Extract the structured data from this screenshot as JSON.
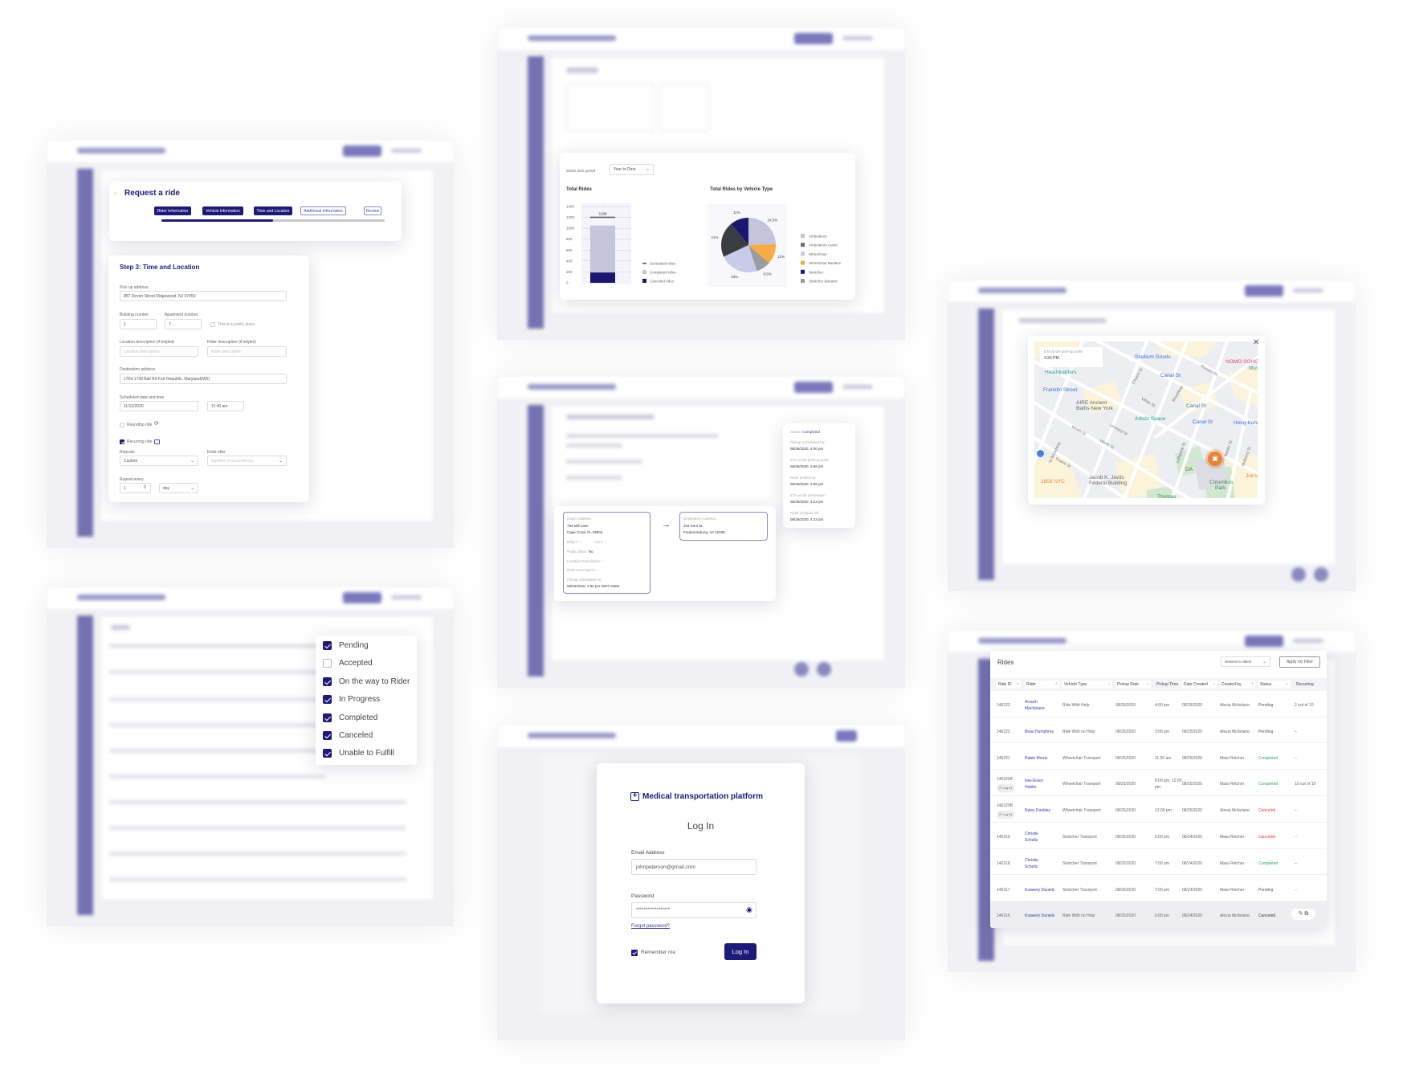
{
  "request_ride": {
    "title": "Request a ride",
    "steps": [
      {
        "label": "Rider Information",
        "done": true
      },
      {
        "label": "Vehicle Information",
        "done": true
      },
      {
        "label": "Time and Location",
        "done": true
      },
      {
        "label": "Additional Information",
        "done": false
      },
      {
        "label": "Review",
        "done": false
      }
    ],
    "progress_percent": 50,
    "form": {
      "title": "Step 3: Time and Location",
      "pickup_label": "Pick up address",
      "pickup_value": "857 Devon Street Ridgewood, NJ 07450",
      "building_label": "Building number",
      "building_value": "1",
      "apartment_label": "Apartment number",
      "apartment_value": "7",
      "public_place_label": "This is a public place",
      "location_desc_label": "Location description (if helpful)",
      "location_desc_placeholder": "Location description",
      "rider_desc_label": "Rider description (if helpful)",
      "rider_desc_placeholder": "Rider description",
      "destination_label": "Destination address",
      "destination_value": "1769-1799 Ball Rd Fort Republic, Maryland(MD)",
      "scheduled_label": "Scheduled date and time",
      "date_value": "11/12/2020",
      "time_value": "11:40 am",
      "roundtrip_label": "Roundtrip ride",
      "recurring_label": "Recurring ride",
      "repeats_label": "Repeats",
      "repeats_value": "Custom",
      "ends_after_label": "Ends after",
      "ends_after_placeholder": "Number of occurrences",
      "repeat_every_label": "Repeat every",
      "repeat_every_value": "1",
      "repeat_unit_value": "day"
    }
  },
  "dashboard": {
    "time_period_label": "Select time period",
    "time_period_value": "Year to Date"
  },
  "chart_data": [
    {
      "type": "bar",
      "title": "Total Rides",
      "ylim": [
        0,
        1400
      ],
      "yticks": [
        0,
        200,
        400,
        600,
        800,
        1000,
        1200,
        1400
      ],
      "grid": true,
      "legend": "right",
      "series": [
        {
          "name": "Scheduled rides",
          "value": 1198,
          "color": "#555555"
        },
        {
          "name": "Completed rides",
          "value": 860,
          "color": "#c5c5db"
        },
        {
          "name": "Canceled rides",
          "value": 190,
          "color": "#1b1670"
        }
      ],
      "data_label": "1198"
    },
    {
      "type": "pie",
      "title": "Total Rides by Vehicle Type",
      "legend": "right",
      "slices": [
        {
          "name": "Ambulatory",
          "value": 24.5,
          "label": "24,5%",
          "color": "#c3c3d9"
        },
        {
          "name": "Wheelchair Bariatric",
          "value": 12,
          "label": "12%",
          "color": "#f8aa45"
        },
        {
          "name": "Stretcher Bariatric",
          "value": 8.5,
          "label": "8,5%",
          "color": "#9c9c9c"
        },
        {
          "name": "Wheelchair",
          "value": 23,
          "label": "23%",
          "color": "#c8cbe9"
        },
        {
          "name": "Ambulatory Assist",
          "value": 21,
          "label": "21%",
          "color": "#3b3b42"
        },
        {
          "name": "Stretcher",
          "value": 11,
          "label": "11%",
          "color": "#1b1670"
        }
      ],
      "legend_order": [
        "Ambulatory",
        "Ambulatory Assist",
        "Wheelchair",
        "Wheelchair Bariatric",
        "Stretcher",
        "Stretcher Bariatric"
      ]
    }
  ],
  "map": {
    "eta_label": "ETA at the pick-up point:",
    "eta_value": "3:26 PM",
    "labels": [
      "Stadium Goods",
      "NOMO SOHO",
      "Canal St",
      "Howard St",
      "Headquarters",
      "Franklin Street",
      "Church St",
      "Mus Chi",
      "Broadway",
      "White St",
      "AIRE Ancient",
      "Baths New York",
      "Canal St",
      "Artists Space",
      "Canal St",
      "Hong Kong",
      "Worth St",
      "Leonard St",
      "Worth St",
      "Lafayette St",
      "Baxter St",
      "Mulberry St",
      "W Broadway",
      "Duane St",
      "DA",
      "1803 NYC",
      "Jacob K. Javits",
      "Federal Building",
      "Columbus",
      "Park",
      "Joe's",
      "Thomas"
    ]
  },
  "ride_details": {
    "status_label": "Status:",
    "status_value": "Completed",
    "timeline": [
      {
        "label": "Pickup Scheduled for:",
        "value": "08/26/2020, 4:00 pm"
      },
      {
        "label": "ETA at the pick-up point:",
        "value": "08/26/2020, 3:56 pm"
      },
      {
        "label": "Rider picked-up:",
        "value": "08/26/2020, 3:56 pm"
      },
      {
        "label": "ETA at the destination:",
        "value": "08/26/2020, 4:23 pm"
      },
      {
        "label": "Rider dropped off:",
        "value": "08/26/2020, 4:23 pm"
      }
    ],
    "origin": {
      "label": "Origin Address:",
      "line1": "793 Mill Lane",
      "line2": "Cape Coral, FL 33904",
      "bldg": "Bldg #: –",
      "apt": "Apt #: –",
      "public_label": "Public place:",
      "public_value": "No",
      "location_desc": "Location Description: –",
      "rider_desc": "Rider Description: –",
      "pickup_label": "Pickup Scheduled for:",
      "pickup_value": "08/26/2020, 4:00 pm GMT+0300"
    },
    "destination": {
      "label": "Destination Address:",
      "line1": "334 Kent St.",
      "line2": "Fredericksburg, VA 22405"
    }
  },
  "status_filter": {
    "options": [
      {
        "label": "Pending",
        "checked": true
      },
      {
        "label": "Accepted",
        "checked": false
      },
      {
        "label": "On the way to Rider",
        "checked": true
      },
      {
        "label": "In Progress",
        "checked": true
      },
      {
        "label": "Completed",
        "checked": true
      },
      {
        "label": "Canceled",
        "checked": true
      },
      {
        "label": "Unable to Fulfill",
        "checked": true
      }
    ]
  },
  "login": {
    "brand": "Medical transportation platform",
    "title": "Log In",
    "email_label": "Email Address",
    "email_value": "johnpeterson@gmail.com",
    "password_label": "Password",
    "password_value": "******************",
    "forgot": "Forgot password?",
    "remember": "Remember me",
    "remember_checked": true,
    "submit": "Log In"
  },
  "rides_table": {
    "title": "Rides",
    "sort_value": "Newest to oldest",
    "apply_filter": "Apply my Filter",
    "columns": [
      "Ride ID",
      "Rider",
      "Vehicle Type",
      "Pickup Date",
      "Pickup Time",
      "Date Created",
      "Created by",
      "Status",
      "Recurring"
    ],
    "rows": [
      {
        "id": "146323",
        "leg": "",
        "rider": "Aroush Macfarlane",
        "vehicle": "Ride With Help",
        "pickup_date": "08/26/2020",
        "pickup_time": "4:00 pm",
        "created": "08/25/2020",
        "created_by": "Alexia Mcfarlane",
        "status": "Pending",
        "recurring": "2 out of 10"
      },
      {
        "id": "146322",
        "leg": "",
        "rider": "Beau Humphrey",
        "vehicle": "Ride With no Help",
        "pickup_date": "08/26/2020",
        "pickup_time": "3:00 pm",
        "created": "08/25/2020",
        "created_by": "Alexia Mcfarlane",
        "status": "Pending",
        "recurring": "–"
      },
      {
        "id": "146321",
        "leg": "",
        "rider": "Rabia Morris",
        "vehicle": "Wheelchair Transport",
        "pickup_date": "08/26/2020",
        "pickup_time": "11:00 am",
        "created": "08/25/2020",
        "created_by": "Maia Fletcher",
        "status": "Completed",
        "recurring": "–"
      },
      {
        "id": "146320A",
        "leg": "Leg #1",
        "rider": "Isla-Grace Hobbs",
        "vehicle": "Wheelchair Transport",
        "pickup_date": "08/25/2020",
        "pickup_time": "8:00 pm, 12:00 pm",
        "created": "08/25/2020",
        "created_by": "Maia Fletcher",
        "status": "Completed",
        "recurring": "10 out of 10"
      },
      {
        "id": "146320B",
        "leg": "Leg #1",
        "rider": "Ryley Dunkley",
        "vehicle": "Wheelchair Transport",
        "pickup_date": "08/25/2020",
        "pickup_time": "12:00 pm",
        "created": "08/25/2020",
        "created_by": "Alexia Mcfarlane",
        "status": "Canceled",
        "recurring": "–"
      },
      {
        "id": "146319",
        "leg": "",
        "rider": "Christie Schultz",
        "vehicle": "Stretcher Transport",
        "pickup_date": "08/25/2020",
        "pickup_time": "6:00 pm",
        "created": "08/24/2020",
        "created_by": "Maia Fletcher",
        "status": "Canceled",
        "recurring": "–"
      },
      {
        "id": "146318",
        "leg": "",
        "rider": "Christie Schultz",
        "vehicle": "Stretcher Transport",
        "pickup_date": "08/25/2020",
        "pickup_time": "7:00 am",
        "created": "08/24/2020",
        "created_by": "Maia Fletcher",
        "status": "Completed",
        "recurring": "–"
      },
      {
        "id": "146317",
        "leg": "",
        "rider": "Ksawery Daniels",
        "vehicle": "Stretcher Transport",
        "pickup_date": "08/25/2020",
        "pickup_time": "7:00 pm",
        "created": "08/24/2020",
        "created_by": "Maia Fletcher",
        "status": "Pending",
        "recurring": "–"
      },
      {
        "id": "146316",
        "leg": "",
        "rider": "Ksawery Daniels",
        "vehicle": "Ride With no Help",
        "pickup_date": "08/25/2020",
        "pickup_time": "6:00 pm",
        "created": "08/24/2020",
        "created_by": "Alexia Mcfarlane",
        "status": "Canceled",
        "recurring": ""
      }
    ]
  },
  "colors": {
    "brand": "#1e1a78",
    "sidebar": "#7471b0",
    "completed": "#38a567",
    "canceled": "#e53935"
  }
}
